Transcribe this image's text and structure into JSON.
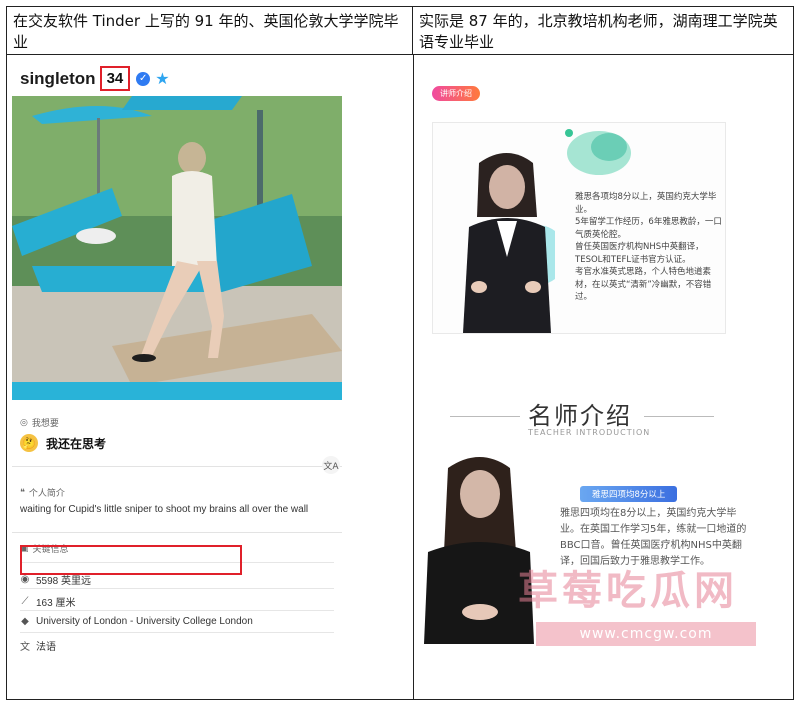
{
  "header": {
    "left": "在交友软件 Tinder 上写的 91 年的、英国伦敦大学学院毕业",
    "right": "实际是 87 年的，北京教培机构老师，湖南理工学院英语专业毕业"
  },
  "profile": {
    "name": "singleton",
    "age": "34",
    "want_title": "我想要",
    "want_text": "我还在思考",
    "bio_title": "个人简介",
    "bio_text": "waiting for Cupid's little sniper to shoot my brains all over the wall",
    "key_title": "关键信息",
    "distance": "5598 英里远",
    "height": "163 厘米",
    "school": "University of London - University College London",
    "language": "法语"
  },
  "promo1": {
    "tag": "讲师介绍",
    "lines": [
      "雅思各项均8分以上，英国约克大学毕业。",
      "5年留学工作经历，6年雅思教龄，一口气质英伦腔。",
      "曾任英国医疗机构NHS中英翻译，TESOL和TEFL证书官方认证。",
      "考官水准英式思路，个人特色地道素材，在以英式“清新”冷幽默，不容错过。"
    ]
  },
  "promo2": {
    "title": "名师介绍",
    "subtitle": "TEACHER INTRODUCTION",
    "pill": "雅思四项均8分以上",
    "text": "雅思四项均在8分以上，英国约克大学毕业。在英国工作学习5年，练就一口地道的BBC口音。曾任英国医疗机构NHS中英翻译，回国后致力于雅思教学工作。",
    "watermark": "草莓吃瓜网",
    "url": "www.cmcgw.com"
  },
  "colors": {
    "highlight": "#e0202a",
    "verify": "#2f7bf2",
    "cyan": "#2fb2d6"
  }
}
